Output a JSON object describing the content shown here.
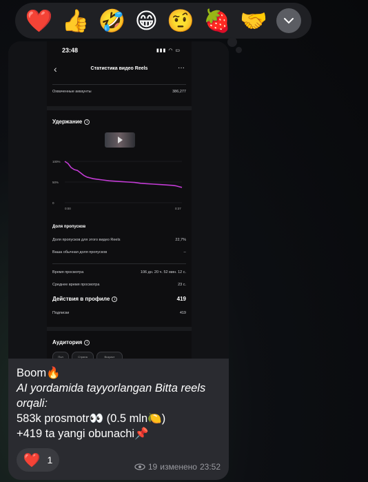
{
  "reactions": {
    "items": [
      {
        "emoji": "❤️",
        "name": "heart"
      },
      {
        "emoji": "👍",
        "name": "thumbs-up"
      },
      {
        "emoji": "🤣",
        "name": "rofl"
      },
      {
        "emoji": "😁",
        "name": "grin"
      },
      {
        "emoji": "🤨",
        "name": "raised-eyebrow"
      },
      {
        "emoji": "🍓",
        "name": "strawberry"
      },
      {
        "emoji": "🤝",
        "name": "handshake"
      }
    ],
    "more_icon": "chevron-down-icon"
  },
  "screenshot": {
    "status_time": "23:48",
    "title": "Статистика видео Reels",
    "reach_label": "Охваченные аккаунты",
    "reach_value": "386,277",
    "retention_title": "Удержание",
    "y_ticks": [
      "100%",
      "50%",
      "0"
    ],
    "x_ticks": [
      "0:00",
      "0:37"
    ],
    "skip_title": "Доля пропусков",
    "skip_rate_label": "Доля пропусков для этого видео Reels",
    "skip_rate_value": "22,7%",
    "usual_skip_label": "Ваша обычная доля пропусков",
    "usual_skip_value": "--",
    "watch_time_label": "Время просмотра",
    "watch_time_value": "106 дн. 20 ч. 52 мин. 12 с.",
    "avg_time_label": "Среднее время просмотра",
    "avg_time_value": "23 с.",
    "profile_actions_title": "Действия в профиле",
    "profile_actions_value": "419",
    "follows_label": "Подписки",
    "follows_value": "419",
    "audience_title": "Аудитория",
    "audience_tabs": [
      "Пол",
      "Страна",
      "Возраст"
    ]
  },
  "chart_data": {
    "type": "line",
    "xlabel": "",
    "ylabel": "",
    "x": [
      0,
      1,
      2,
      3,
      4,
      5,
      6,
      7,
      8,
      9,
      10,
      12,
      14,
      16,
      18,
      20,
      22,
      24,
      26,
      28,
      30,
      32,
      34,
      35,
      36,
      37
    ],
    "series": [
      {
        "values": [
          100,
          95,
          85,
          80,
          78,
          72,
          66,
          62,
          60,
          58,
          57,
          55,
          53,
          52,
          51,
          50,
          49,
          47,
          46,
          45,
          44,
          43,
          42,
          41,
          39,
          37
        ]
      }
    ],
    "xlim": [
      0,
      37
    ],
    "ylim": [
      0,
      100
    ],
    "color": "#c43cd6"
  },
  "message": {
    "line1": "Boom🔥",
    "line2": "AI yordamida tayyorlangan Bitta reels orqali:",
    "line3": "583k prosmotr👀 (0.5 mln🍋)",
    "line4": "+419 ta yangi obunachi📌",
    "reaction_emoji": "❤️",
    "reaction_count": "1",
    "views": "19",
    "edited_label": "изменено",
    "time": "23:52"
  }
}
